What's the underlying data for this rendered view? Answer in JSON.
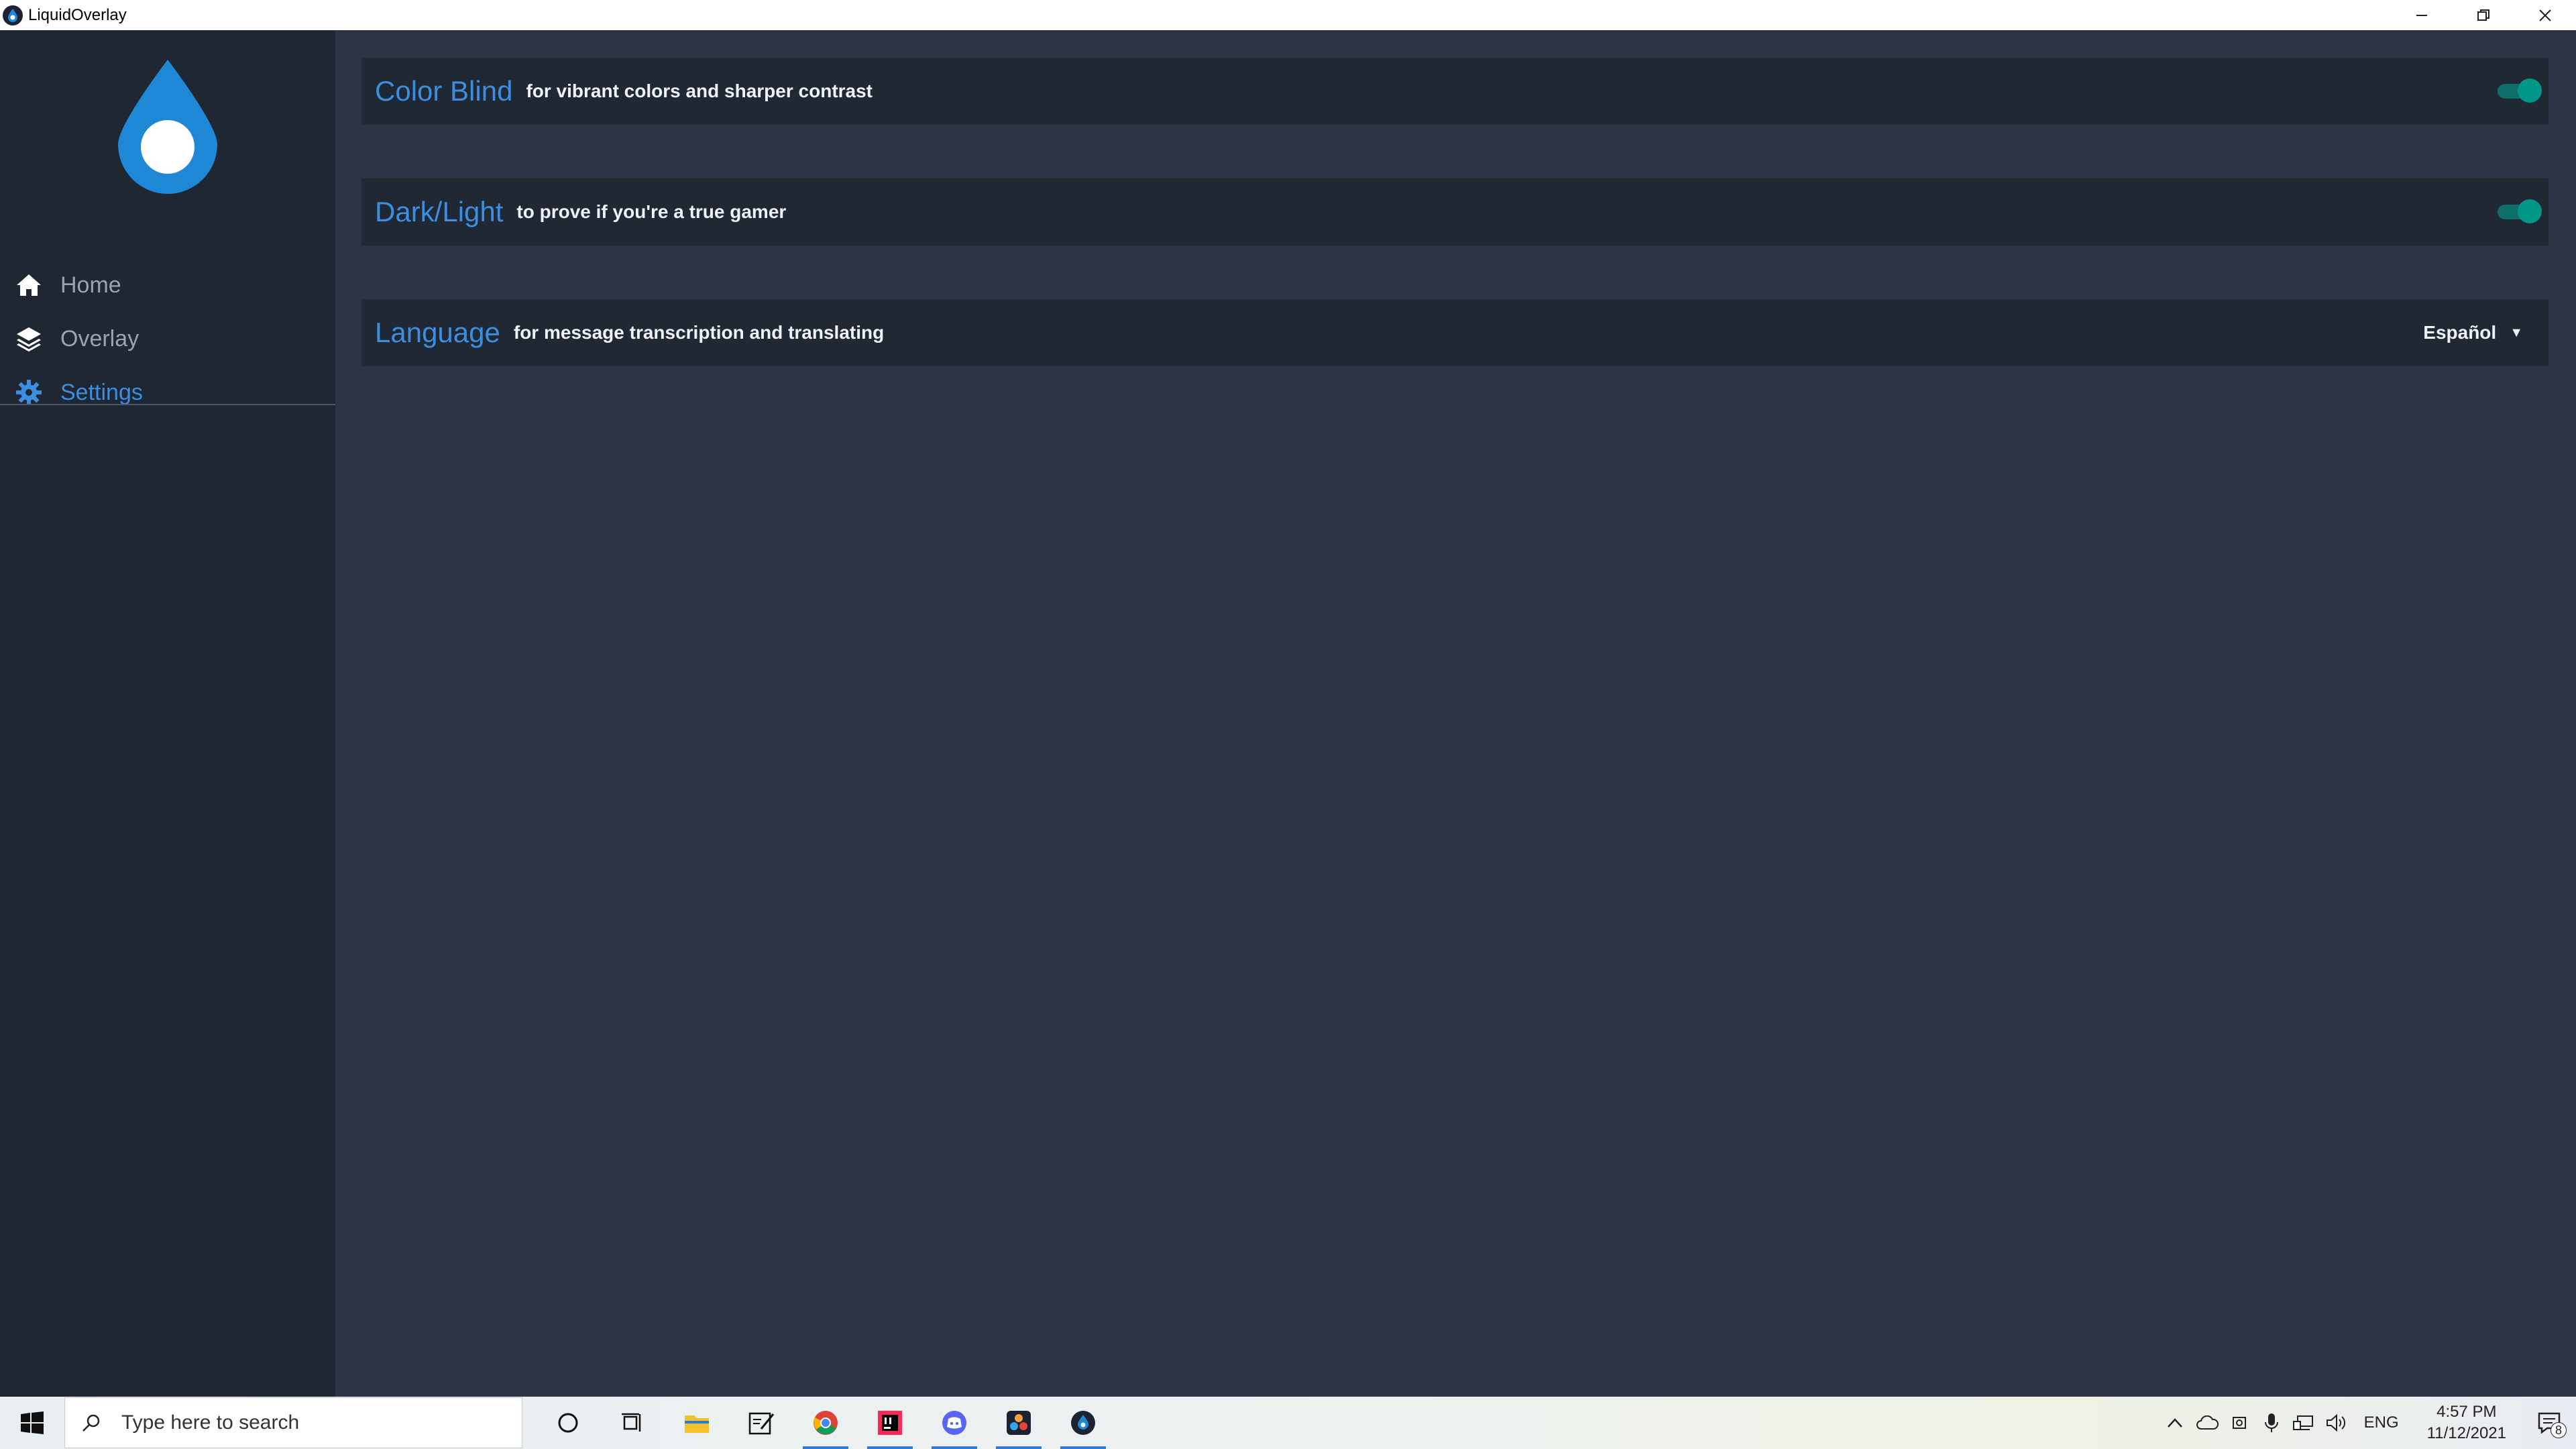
{
  "window": {
    "title": "LiquidOverlay"
  },
  "sidebar": {
    "items": [
      {
        "label": "Home",
        "icon": "home-icon"
      },
      {
        "label": "Overlay",
        "icon": "layers-icon"
      },
      {
        "label": "Settings",
        "icon": "gear-icon",
        "active": true
      }
    ]
  },
  "settings": {
    "color_blind": {
      "title": "Color Blind",
      "description": "for vibrant colors and sharper contrast",
      "enabled": true
    },
    "dark_light": {
      "title": "Dark/Light",
      "description": "to prove if you're a true gamer",
      "enabled": true
    },
    "language": {
      "title": "Language",
      "description": "for message transcription and translating",
      "selected": "Español"
    }
  },
  "taskbar": {
    "search_placeholder": "Type here to search",
    "language_indicator": "ENG",
    "time": "4:57 PM",
    "date": "11/12/2021",
    "notification_count": "8"
  },
  "colors": {
    "accent": "#3b8ee0",
    "sidebar_bg": "#1f2733",
    "main_bg": "#2b3546",
    "row_bg": "#202834",
    "toggle_on": "#009688"
  }
}
